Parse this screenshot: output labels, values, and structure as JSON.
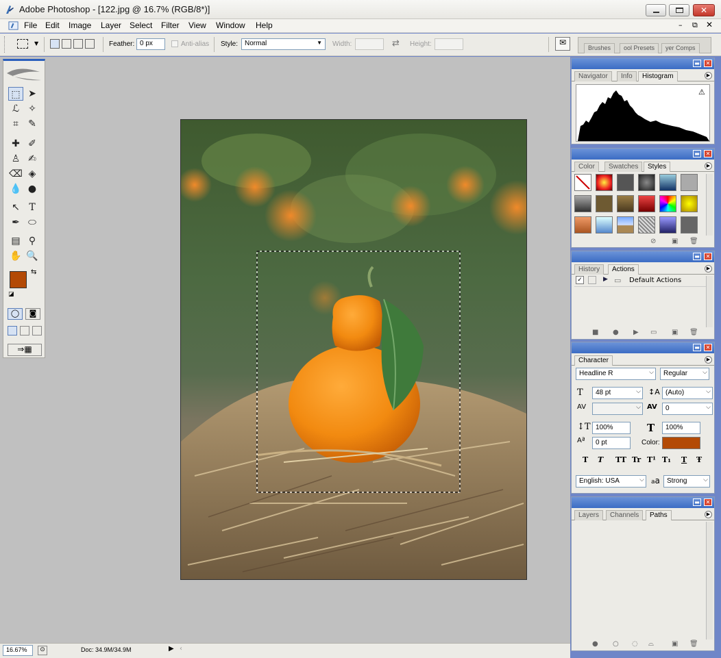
{
  "window": {
    "title": "Adobe Photoshop - [122.jpg @ 16.7% (RGB/8*)]"
  },
  "menu": [
    "File",
    "Edit",
    "Image",
    "Layer",
    "Select",
    "Filter",
    "View",
    "Window",
    "Help"
  ],
  "options_bar": {
    "feather_label": "Feather:",
    "feather_value": "0 px",
    "antialias_label": "Anti-alias",
    "style_label": "Style:",
    "style_value": "Normal",
    "width_label": "Width:",
    "height_label": "Height:",
    "well_tabs": [
      "Brushes",
      "ool Presets",
      "yer Comps"
    ]
  },
  "colors": {
    "foreground": "#b34a06",
    "background": "#2257b0",
    "title_gradient": "#3b6cc4"
  },
  "navigator_palette": {
    "tabs": [
      "Navigator",
      "Info",
      "Histogram"
    ],
    "active_tab": "Histogram"
  },
  "styles_palette": {
    "tabs": [
      "Color",
      "Swatches",
      "Styles"
    ],
    "active_tab": "Styles"
  },
  "actions_palette": {
    "tabs": [
      "History",
      "Actions"
    ],
    "active_tab": "Actions",
    "items": [
      "Default Actions"
    ]
  },
  "character_palette": {
    "tab": "Character",
    "font_family": "Headline R",
    "font_style": "Regular",
    "font_size": "48 pt",
    "leading": "(Auto)",
    "kerning": "",
    "tracking": "0",
    "vertical_scale": "100%",
    "horizontal_scale": "100%",
    "baseline_shift": "0 pt",
    "color_label": "Color:",
    "color": "#b34a06",
    "language": "English: USA",
    "antialias_glyph": "a",
    "antialias": "Strong",
    "style_buttons": [
      "T",
      "T",
      "TT",
      "Tr",
      "T¹",
      "T₁",
      "T",
      "Ŧ"
    ]
  },
  "layers_palette": {
    "tabs": [
      "Layers",
      "Channels",
      "Paths"
    ],
    "active_tab": "Paths"
  },
  "status": {
    "zoom": "16.67%",
    "doc": "Doc: 34.9M/34.9M"
  }
}
